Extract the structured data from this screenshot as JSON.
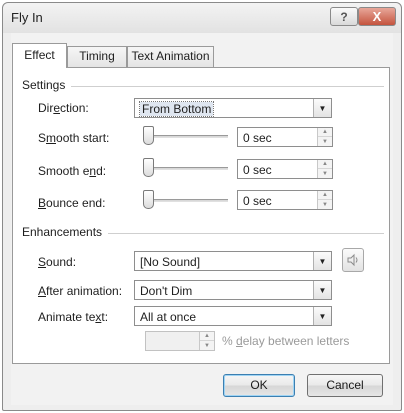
{
  "window": {
    "title": "Fly In",
    "help_glyph": "?",
    "close_glyph": "X"
  },
  "tabs": [
    {
      "label": "Effect",
      "active": true
    },
    {
      "label": "Timing",
      "active": false
    },
    {
      "label": "Text Animation",
      "active": false
    }
  ],
  "settings": {
    "group_label": "Settings",
    "direction": {
      "label_pre": "Dir",
      "label_u": "e",
      "label_post": "ction:",
      "value": "From Bottom"
    },
    "smooth_start": {
      "label_pre": "S",
      "label_u": "m",
      "label_post": "ooth start:",
      "value": "0 sec"
    },
    "smooth_end": {
      "label_pre": "Smooth e",
      "label_u": "n",
      "label_post": "d:",
      "value": "0 sec"
    },
    "bounce_end": {
      "label_pre": "",
      "label_u": "B",
      "label_post": "ounce end:",
      "value": "0 sec"
    }
  },
  "enhancements": {
    "group_label": "Enhancements",
    "sound": {
      "label_pre": "",
      "label_u": "S",
      "label_post": "ound:",
      "value": "[No Sound]"
    },
    "after_animation": {
      "label_pre": "",
      "label_u": "A",
      "label_post": "fter animation:",
      "value": "Don't Dim"
    },
    "animate_text": {
      "label_pre": "Animate te",
      "label_u": "x",
      "label_post": "t:",
      "value": "All at once"
    },
    "delay": {
      "value": "",
      "label_pre": "% ",
      "label_u": "d",
      "label_post": "elay between letters"
    }
  },
  "buttons": {
    "ok": "OK",
    "cancel": "Cancel"
  }
}
